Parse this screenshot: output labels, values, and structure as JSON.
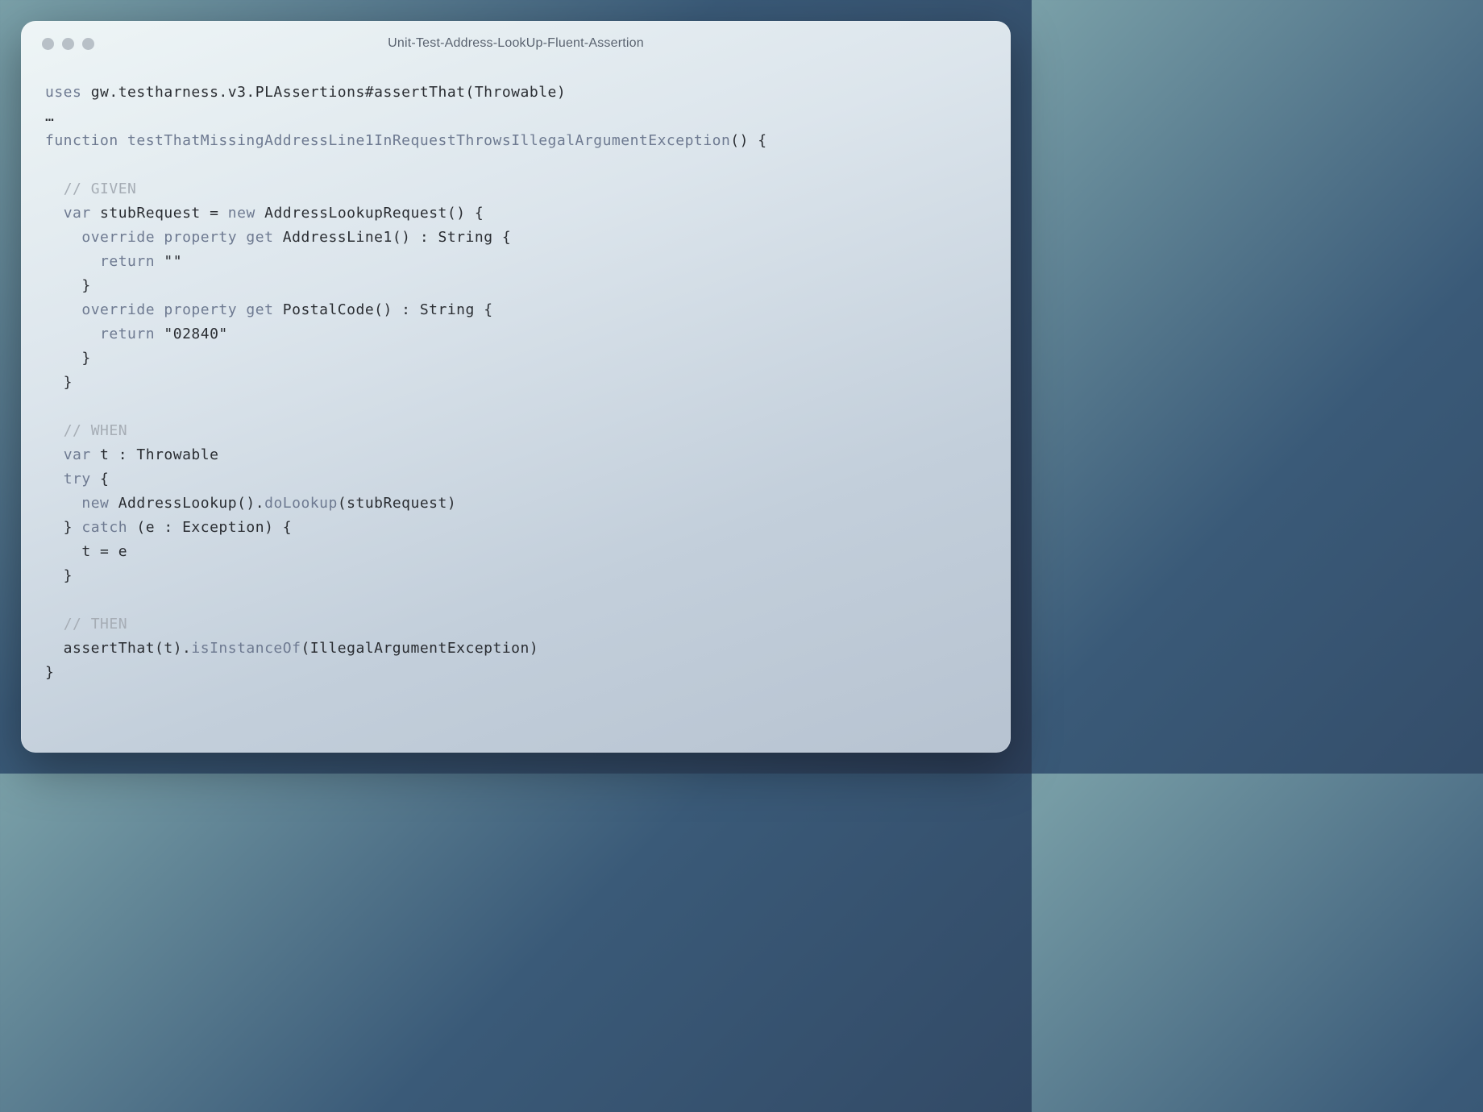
{
  "window": {
    "title": "Unit-Test-Address-LookUp-Fluent-Assertion"
  },
  "code": {
    "tokens": [
      {
        "t": "uses ",
        "c": "kw"
      },
      {
        "t": "gw.testharness.v3.PLAssertions#assertThat(Throwable)",
        "c": ""
      },
      {
        "t": "\n",
        "c": ""
      },
      {
        "t": "…",
        "c": ""
      },
      {
        "t": "\n",
        "c": ""
      },
      {
        "t": "function ",
        "c": "kw"
      },
      {
        "t": "testThatMissingAddressLine1InRequestThrowsIllegalArgumentException",
        "c": "fn"
      },
      {
        "t": "() {",
        "c": ""
      },
      {
        "t": "\n",
        "c": ""
      },
      {
        "t": "\n",
        "c": ""
      },
      {
        "t": "  ",
        "c": ""
      },
      {
        "t": "// GIVEN",
        "c": "comment"
      },
      {
        "t": "\n",
        "c": ""
      },
      {
        "t": "  ",
        "c": ""
      },
      {
        "t": "var ",
        "c": "kw"
      },
      {
        "t": "stubRequest = ",
        "c": ""
      },
      {
        "t": "new ",
        "c": "kw"
      },
      {
        "t": "AddressLookupRequest() {",
        "c": ""
      },
      {
        "t": "\n",
        "c": ""
      },
      {
        "t": "    ",
        "c": ""
      },
      {
        "t": "override property get ",
        "c": "kw"
      },
      {
        "t": "AddressLine1() : String {",
        "c": ""
      },
      {
        "t": "\n",
        "c": ""
      },
      {
        "t": "      ",
        "c": ""
      },
      {
        "t": "return ",
        "c": "kw"
      },
      {
        "t": "\"\"",
        "c": "str"
      },
      {
        "t": "\n",
        "c": ""
      },
      {
        "t": "    }",
        "c": ""
      },
      {
        "t": "\n",
        "c": ""
      },
      {
        "t": "    ",
        "c": ""
      },
      {
        "t": "override property get ",
        "c": "kw"
      },
      {
        "t": "PostalCode() : String {",
        "c": ""
      },
      {
        "t": "\n",
        "c": ""
      },
      {
        "t": "      ",
        "c": ""
      },
      {
        "t": "return ",
        "c": "kw"
      },
      {
        "t": "\"02840\"",
        "c": "str"
      },
      {
        "t": "\n",
        "c": ""
      },
      {
        "t": "    }",
        "c": ""
      },
      {
        "t": "\n",
        "c": ""
      },
      {
        "t": "  }",
        "c": ""
      },
      {
        "t": "\n",
        "c": ""
      },
      {
        "t": "\n",
        "c": ""
      },
      {
        "t": "  ",
        "c": ""
      },
      {
        "t": "// WHEN",
        "c": "comment"
      },
      {
        "t": "\n",
        "c": ""
      },
      {
        "t": "  ",
        "c": ""
      },
      {
        "t": "var ",
        "c": "kw"
      },
      {
        "t": "t : Throwable",
        "c": ""
      },
      {
        "t": "\n",
        "c": ""
      },
      {
        "t": "  ",
        "c": ""
      },
      {
        "t": "try ",
        "c": "kw"
      },
      {
        "t": "{",
        "c": ""
      },
      {
        "t": "\n",
        "c": ""
      },
      {
        "t": "    ",
        "c": ""
      },
      {
        "t": "new ",
        "c": "kw"
      },
      {
        "t": "AddressLookup().",
        "c": ""
      },
      {
        "t": "doLookup",
        "c": "fn"
      },
      {
        "t": "(stubRequest)",
        "c": ""
      },
      {
        "t": "\n",
        "c": ""
      },
      {
        "t": "  } ",
        "c": ""
      },
      {
        "t": "catch ",
        "c": "kw"
      },
      {
        "t": "(e : Exception) {",
        "c": ""
      },
      {
        "t": "\n",
        "c": ""
      },
      {
        "t": "    t = e",
        "c": ""
      },
      {
        "t": "\n",
        "c": ""
      },
      {
        "t": "  }",
        "c": ""
      },
      {
        "t": "\n",
        "c": ""
      },
      {
        "t": "\n",
        "c": ""
      },
      {
        "t": "  ",
        "c": ""
      },
      {
        "t": "// THEN",
        "c": "comment"
      },
      {
        "t": "\n",
        "c": ""
      },
      {
        "t": "  assertThat(t).",
        "c": ""
      },
      {
        "t": "isInstanceOf",
        "c": "fn"
      },
      {
        "t": "(IllegalArgumentException)",
        "c": ""
      },
      {
        "t": "\n",
        "c": ""
      },
      {
        "t": "}",
        "c": ""
      }
    ]
  }
}
